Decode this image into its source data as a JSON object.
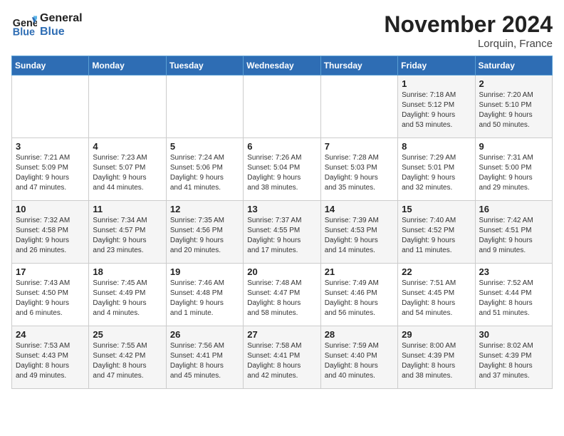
{
  "header": {
    "logo_text_general": "General",
    "logo_text_blue": "Blue",
    "month_title": "November 2024",
    "location": "Lorquin, France"
  },
  "days_of_week": [
    "Sunday",
    "Monday",
    "Tuesday",
    "Wednesday",
    "Thursday",
    "Friday",
    "Saturday"
  ],
  "weeks": [
    [
      {
        "day": "",
        "info": ""
      },
      {
        "day": "",
        "info": ""
      },
      {
        "day": "",
        "info": ""
      },
      {
        "day": "",
        "info": ""
      },
      {
        "day": "",
        "info": ""
      },
      {
        "day": "1",
        "info": "Sunrise: 7:18 AM\nSunset: 5:12 PM\nDaylight: 9 hours\nand 53 minutes."
      },
      {
        "day": "2",
        "info": "Sunrise: 7:20 AM\nSunset: 5:10 PM\nDaylight: 9 hours\nand 50 minutes."
      }
    ],
    [
      {
        "day": "3",
        "info": "Sunrise: 7:21 AM\nSunset: 5:09 PM\nDaylight: 9 hours\nand 47 minutes."
      },
      {
        "day": "4",
        "info": "Sunrise: 7:23 AM\nSunset: 5:07 PM\nDaylight: 9 hours\nand 44 minutes."
      },
      {
        "day": "5",
        "info": "Sunrise: 7:24 AM\nSunset: 5:06 PM\nDaylight: 9 hours\nand 41 minutes."
      },
      {
        "day": "6",
        "info": "Sunrise: 7:26 AM\nSunset: 5:04 PM\nDaylight: 9 hours\nand 38 minutes."
      },
      {
        "day": "7",
        "info": "Sunrise: 7:28 AM\nSunset: 5:03 PM\nDaylight: 9 hours\nand 35 minutes."
      },
      {
        "day": "8",
        "info": "Sunrise: 7:29 AM\nSunset: 5:01 PM\nDaylight: 9 hours\nand 32 minutes."
      },
      {
        "day": "9",
        "info": "Sunrise: 7:31 AM\nSunset: 5:00 PM\nDaylight: 9 hours\nand 29 minutes."
      }
    ],
    [
      {
        "day": "10",
        "info": "Sunrise: 7:32 AM\nSunset: 4:58 PM\nDaylight: 9 hours\nand 26 minutes."
      },
      {
        "day": "11",
        "info": "Sunrise: 7:34 AM\nSunset: 4:57 PM\nDaylight: 9 hours\nand 23 minutes."
      },
      {
        "day": "12",
        "info": "Sunrise: 7:35 AM\nSunset: 4:56 PM\nDaylight: 9 hours\nand 20 minutes."
      },
      {
        "day": "13",
        "info": "Sunrise: 7:37 AM\nSunset: 4:55 PM\nDaylight: 9 hours\nand 17 minutes."
      },
      {
        "day": "14",
        "info": "Sunrise: 7:39 AM\nSunset: 4:53 PM\nDaylight: 9 hours\nand 14 minutes."
      },
      {
        "day": "15",
        "info": "Sunrise: 7:40 AM\nSunset: 4:52 PM\nDaylight: 9 hours\nand 11 minutes."
      },
      {
        "day": "16",
        "info": "Sunrise: 7:42 AM\nSunset: 4:51 PM\nDaylight: 9 hours\nand 9 minutes."
      }
    ],
    [
      {
        "day": "17",
        "info": "Sunrise: 7:43 AM\nSunset: 4:50 PM\nDaylight: 9 hours\nand 6 minutes."
      },
      {
        "day": "18",
        "info": "Sunrise: 7:45 AM\nSunset: 4:49 PM\nDaylight: 9 hours\nand 4 minutes."
      },
      {
        "day": "19",
        "info": "Sunrise: 7:46 AM\nSunset: 4:48 PM\nDaylight: 9 hours\nand 1 minute."
      },
      {
        "day": "20",
        "info": "Sunrise: 7:48 AM\nSunset: 4:47 PM\nDaylight: 8 hours\nand 58 minutes."
      },
      {
        "day": "21",
        "info": "Sunrise: 7:49 AM\nSunset: 4:46 PM\nDaylight: 8 hours\nand 56 minutes."
      },
      {
        "day": "22",
        "info": "Sunrise: 7:51 AM\nSunset: 4:45 PM\nDaylight: 8 hours\nand 54 minutes."
      },
      {
        "day": "23",
        "info": "Sunrise: 7:52 AM\nSunset: 4:44 PM\nDaylight: 8 hours\nand 51 minutes."
      }
    ],
    [
      {
        "day": "24",
        "info": "Sunrise: 7:53 AM\nSunset: 4:43 PM\nDaylight: 8 hours\nand 49 minutes."
      },
      {
        "day": "25",
        "info": "Sunrise: 7:55 AM\nSunset: 4:42 PM\nDaylight: 8 hours\nand 47 minutes."
      },
      {
        "day": "26",
        "info": "Sunrise: 7:56 AM\nSunset: 4:41 PM\nDaylight: 8 hours\nand 45 minutes."
      },
      {
        "day": "27",
        "info": "Sunrise: 7:58 AM\nSunset: 4:41 PM\nDaylight: 8 hours\nand 42 minutes."
      },
      {
        "day": "28",
        "info": "Sunrise: 7:59 AM\nSunset: 4:40 PM\nDaylight: 8 hours\nand 40 minutes."
      },
      {
        "day": "29",
        "info": "Sunrise: 8:00 AM\nSunset: 4:39 PM\nDaylight: 8 hours\nand 38 minutes."
      },
      {
        "day": "30",
        "info": "Sunrise: 8:02 AM\nSunset: 4:39 PM\nDaylight: 8 hours\nand 37 minutes."
      }
    ]
  ]
}
